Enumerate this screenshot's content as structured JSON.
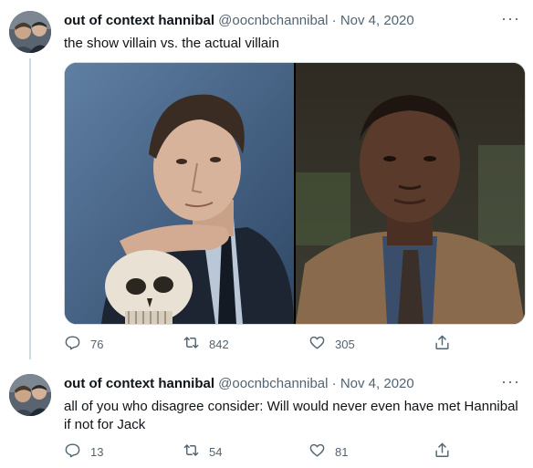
{
  "tweets": [
    {
      "author_name": "out of context hannibal",
      "handle": "@oocnbchannibal",
      "separator": "·",
      "date": "Nov 4, 2020",
      "more": "···",
      "text": "the show villain vs. the actual villain",
      "replies": "76",
      "retweets": "842",
      "likes": "305"
    },
    {
      "author_name": "out of context hannibal",
      "handle": "@oocnbchannibal",
      "separator": "·",
      "date": "Nov 4, 2020",
      "more": "···",
      "text": "all of you who disagree consider: Will would never even have met Hannibal if not for Jack",
      "replies": "13",
      "retweets": "54",
      "likes": "81"
    }
  ],
  "icons": {
    "reply": "reply-icon",
    "retweet": "retweet-icon",
    "like": "heart-icon",
    "share": "share-icon",
    "more": "more-icon"
  },
  "colors": {
    "text": "#0f1419",
    "muted": "#536471",
    "divider": "#cfd9de"
  }
}
